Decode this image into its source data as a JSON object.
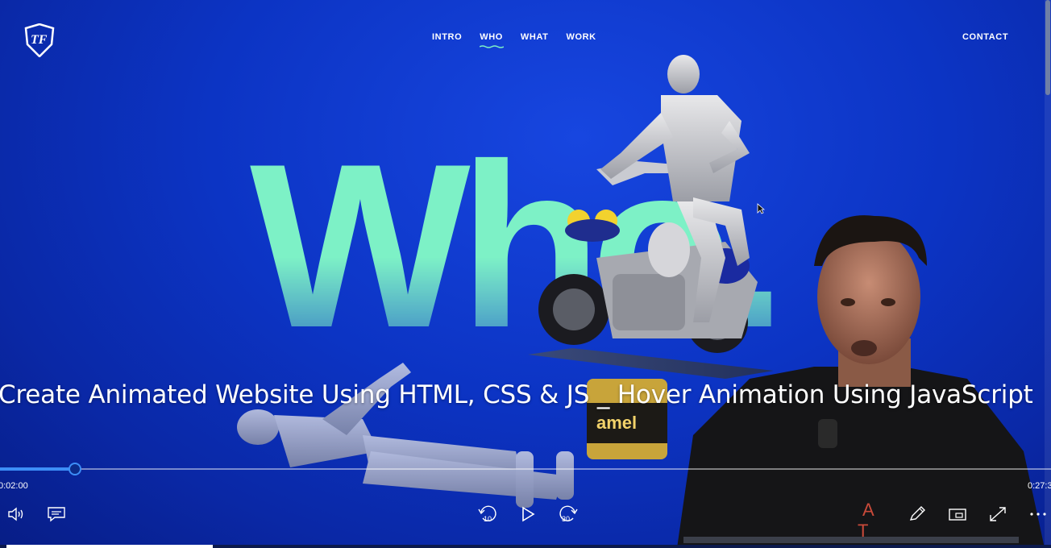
{
  "site": {
    "logo_letters": "TF",
    "nav": [
      {
        "label": "INTRO",
        "active": false
      },
      {
        "label": "WHO",
        "active": true
      },
      {
        "label": "WHAT",
        "active": false
      },
      {
        "label": "WORK",
        "active": false
      }
    ],
    "contact_label": "CONTACT",
    "hero_word": "Who.",
    "label_text": "Super Enamel",
    "accent_color": "#7df1c6",
    "background_color": "#0c34c4"
  },
  "player": {
    "title": "Create Animated Website Using HTML, CSS & JS _ Hover Animation Using JavaScript",
    "current_time": "0:02:00",
    "total_time": "0:27:3",
    "progress": 0.071,
    "accent_color": "#3d8ef7",
    "controls": {
      "left": [
        "volume-icon",
        "captions-icon"
      ],
      "center": [
        "rewind-10-icon",
        "play-icon",
        "forward-30-icon"
      ],
      "right": [
        "pencil-icon",
        "mini-view-icon",
        "fullscreen-icon",
        "more-icon"
      ],
      "rewind_seconds": "10",
      "forward_seconds": "30"
    }
  }
}
